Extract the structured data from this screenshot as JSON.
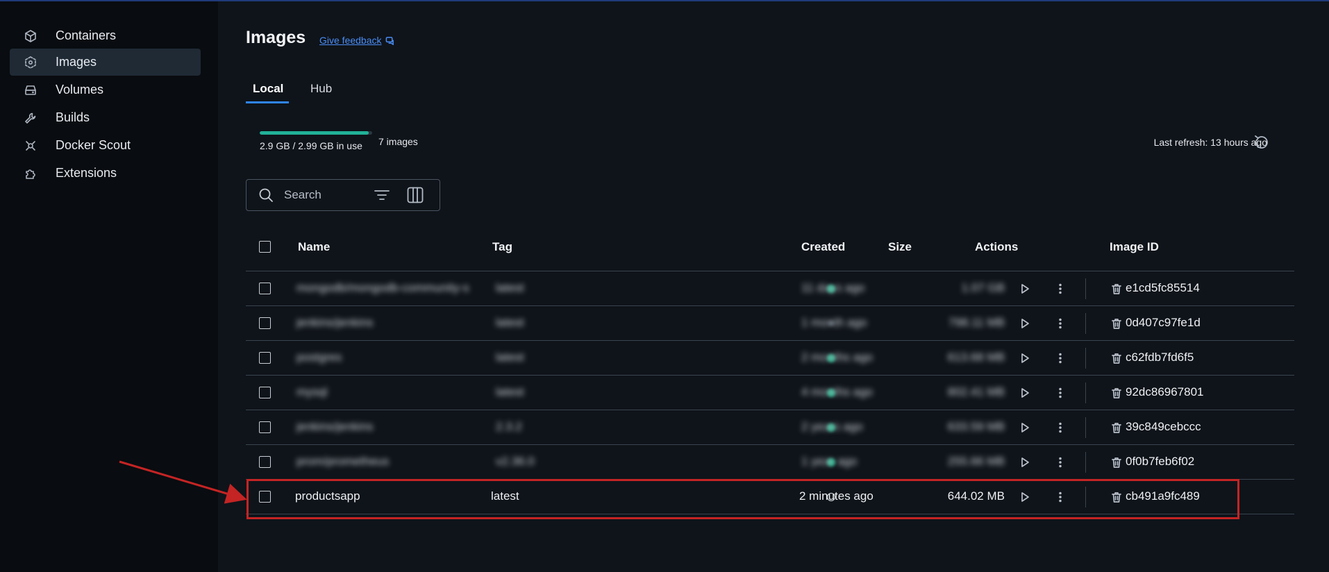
{
  "sidebar": {
    "items": [
      {
        "label": "Containers",
        "icon": "cube-icon",
        "active": false
      },
      {
        "label": "Images",
        "icon": "image-layers-icon",
        "active": true
      },
      {
        "label": "Volumes",
        "icon": "drive-icon",
        "active": false
      },
      {
        "label": "Builds",
        "icon": "wrench-icon",
        "active": false
      },
      {
        "label": "Docker Scout",
        "icon": "scout-icon",
        "active": false
      },
      {
        "label": "Extensions",
        "icon": "puzzle-icon",
        "active": false
      }
    ]
  },
  "page": {
    "title": "Images",
    "feedback_link": "Give feedback"
  },
  "tabs": [
    {
      "label": "Local",
      "active": true
    },
    {
      "label": "Hub",
      "active": false
    }
  ],
  "usage": {
    "text": "2.9 GB / 2.99 GB in use",
    "fraction": 0.97,
    "images_count": "7 images",
    "last_refresh": "Last refresh: 13 hours ago"
  },
  "search": {
    "placeholder": "Search",
    "value": ""
  },
  "table": {
    "columns": {
      "name": "Name",
      "tag": "Tag",
      "created": "Created",
      "size": "Size",
      "actions": "Actions",
      "image_id": "Image ID"
    },
    "rows": [
      {
        "name": "mongodb/mongodb-community-s",
        "tag": "latest",
        "status": "in-use",
        "created": "11 days ago",
        "size": "1.07 GB",
        "image_id": "e1cd5fc85514",
        "blurred": true
      },
      {
        "name": "jenkins/jenkins",
        "tag": "latest",
        "status": "unused",
        "created": "1 month ago",
        "size": "798.11 MB",
        "image_id": "0d407c97fe1d",
        "blurred": true
      },
      {
        "name": "postgres",
        "tag": "latest",
        "status": "in-use",
        "created": "2 months ago",
        "size": "613.68 MB",
        "image_id": "c62fdb7fd6f5",
        "blurred": true
      },
      {
        "name": "mysql",
        "tag": "latest",
        "status": "in-use",
        "created": "4 months ago",
        "size": "802.41 MB",
        "image_id": "92dc86967801",
        "blurred": true
      },
      {
        "name": "jenkins/jenkins",
        "tag": "2.3.2",
        "status": "in-use",
        "created": "2 years ago",
        "size": "633.59 MB",
        "image_id": "39c849cebccc",
        "blurred": true
      },
      {
        "name": "prom/prometheus",
        "tag": "v2.36.0",
        "status": "in-use",
        "created": "1 year ago",
        "size": "255.66 MB",
        "image_id": "0f0b7feb6f02",
        "blurred": true
      },
      {
        "name": "productsapp",
        "tag": "latest",
        "status": "unused-ring",
        "created": "2 minutes ago",
        "size": "644.02 MB",
        "image_id": "cb491a9fc489",
        "blurred": false
      }
    ]
  },
  "colors": {
    "accent": "#2f84f3",
    "usage_fill": "#21b198",
    "highlight": "#c42424"
  }
}
